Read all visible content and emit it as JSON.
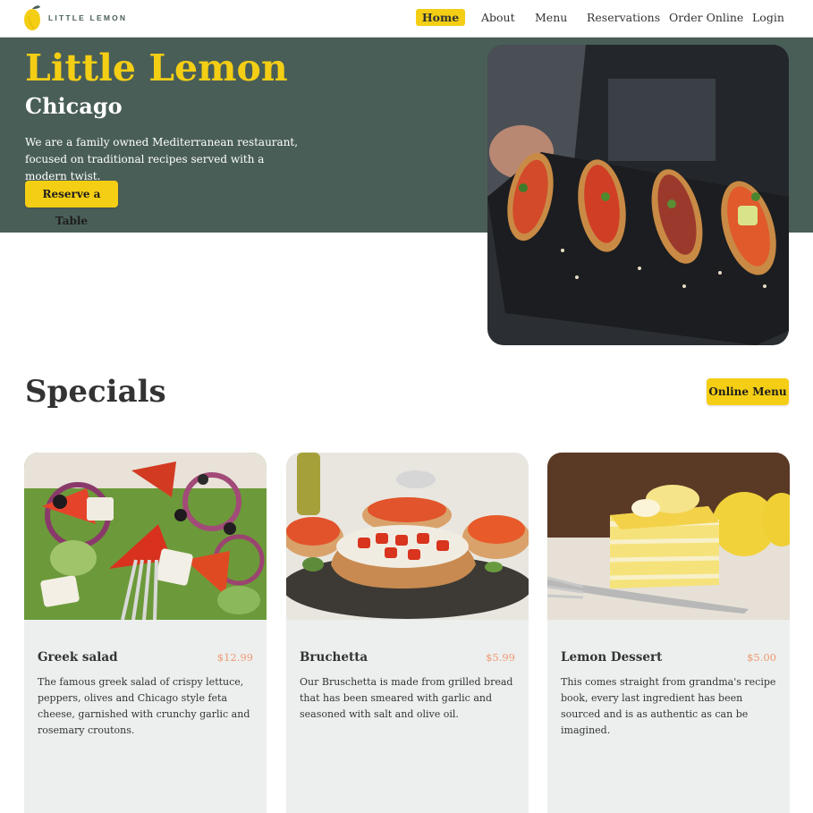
{
  "header": {
    "logo_text": "LITTLE LEMON",
    "nav": [
      {
        "label": "Home",
        "active": true
      },
      {
        "label": "About",
        "active": false
      },
      {
        "label": "Menu",
        "active": false
      },
      {
        "label": "Reservations",
        "active": false
      },
      {
        "label": "Order Online",
        "active": false
      },
      {
        "label": "Login",
        "active": false
      }
    ]
  },
  "hero": {
    "title": "Little Lemon",
    "city": "Chicago",
    "description": "We are a family owned Mediterranean restaurant, focused on traditional recipes served with a modern twist.",
    "cta_label": "Reserve a Table",
    "image_icon": "bruschetta-platter-photo"
  },
  "specials": {
    "title": "Specials",
    "menu_button_label": "Online Menu",
    "cards": [
      {
        "name": "Greek salad",
        "price": "$12.99",
        "description": "The famous greek salad of crispy lettuce, peppers, olives and Chicago style feta cheese, garnished with crunchy garlic and rosemary croutons.",
        "image_icon": "greek-salad-photo"
      },
      {
        "name": "Bruchetta",
        "price": "$5.99",
        "description": "Our Bruschetta is made from grilled bread that has been smeared with garlic and seasoned with salt and olive oil.",
        "image_icon": "bruschetta-photo"
      },
      {
        "name": "Lemon Dessert",
        "price": "$5.00",
        "description": "This comes straight from grandma's recipe book, every last ingredient has been sourced and is as authentic as can be imagined.",
        "image_icon": "lemon-cake-photo"
      }
    ]
  },
  "colors": {
    "primary_green": "#495E57",
    "primary_yellow": "#F4CE14",
    "card_bg": "#EDEFEE",
    "price": "#EE9972"
  }
}
